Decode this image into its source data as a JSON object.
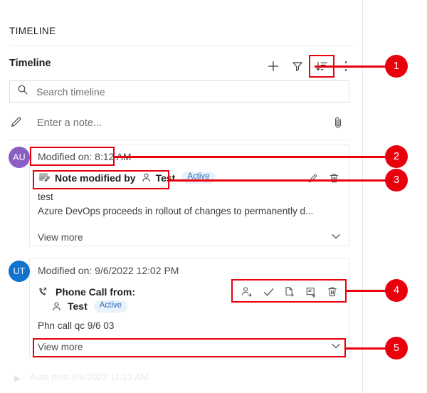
{
  "panel": {
    "section_title": "TIMELINE",
    "timeline_label": "Timeline",
    "toolbar": {
      "add_label": "+",
      "filter_icon": "funnel-icon",
      "sort_icon": "sort-icon",
      "more_icon": "more-vertical-icon"
    },
    "search": {
      "placeholder": "Search timeline",
      "value": "",
      "icon": "search-icon"
    },
    "note_input": {
      "placeholder": "Enter a note...",
      "value": "",
      "icon": "pencil-icon",
      "attach_icon": "paperclip-icon"
    }
  },
  "entries": [
    {
      "avatar_initials": "AU",
      "avatar_color": "#8B5EC4",
      "date_label": "Modified on: 8:12 AM",
      "title": "Note modified by",
      "person": "Test",
      "status": "Active",
      "type_icon": "note-icon",
      "person_icon": "person-icon",
      "body_line1": "test",
      "body_line2": "Azure DevOps proceeds in rollout of changes to permanently d...",
      "view_more": "View more",
      "actions": [
        {
          "name": "edit-icon"
        },
        {
          "name": "delete-icon"
        }
      ]
    },
    {
      "avatar_initials": "UT",
      "avatar_color": "#1273CD",
      "date_label": "Modified on: 9/6/2022 12:02 PM",
      "title": "Phone Call from:",
      "person": "Test",
      "status": "Active",
      "type_icon": "phone-call-icon",
      "person_icon": "person-icon",
      "body_line1": "Phn call qc 9/6 03",
      "view_more": "View more",
      "actions": [
        {
          "name": "assign-person-icon"
        },
        {
          "name": "mark-complete-icon"
        },
        {
          "name": "convert-to-icon"
        },
        {
          "name": "open-record-icon"
        },
        {
          "name": "delete-icon"
        }
      ]
    }
  ],
  "partial_entry": {
    "text": "Auto post 9/6/2022 11:13 AM"
  },
  "callouts": [
    {
      "number": "1"
    },
    {
      "number": "2"
    },
    {
      "number": "3"
    },
    {
      "number": "4"
    },
    {
      "number": "5"
    }
  ],
  "colors": {
    "callout_red": "#e8000d",
    "badge_text": "#2a6bb5",
    "badge_bg": "#e9f1fb"
  }
}
